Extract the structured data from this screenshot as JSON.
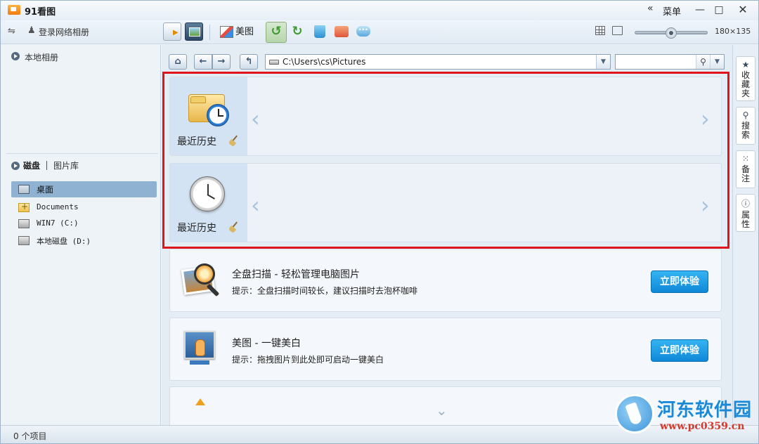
{
  "window": {
    "title": "91看图",
    "menu_label": "菜单",
    "menu_chevron": "«",
    "minimize": "—",
    "maximize": "□",
    "close": "✕"
  },
  "toolbar": {
    "login_label": "登录网络相册",
    "usb_glyph": "⇋",
    "user_glyph": "♟",
    "meitu_label": "美图",
    "rotate_left_glyph": "↺",
    "rotate_right_glyph": "↻",
    "zoom_value": "180×135",
    "zoom_level": 0.5
  },
  "left_panel": {
    "local_album_label": "本地相册",
    "disk_tab": "磁盘",
    "library_tab": "图片库",
    "tree": [
      {
        "label": "桌面",
        "icon": "desktop-icon",
        "selected": true
      },
      {
        "label": "Documents",
        "icon": "folder-icon",
        "selected": false
      },
      {
        "label": "WIN7 (C:)",
        "icon": "drive-icon",
        "selected": false
      },
      {
        "label": "本地磁盘 (D:)",
        "icon": "drive-icon",
        "selected": false
      }
    ]
  },
  "navbar": {
    "home_glyph": "⌂",
    "back_glyph": "←",
    "forward_glyph": "→",
    "up_glyph": "↰",
    "path": "C:\\Users\\cs\\Pictures",
    "dropdown_glyph": "▼",
    "search_value": "",
    "search_glyph": "⚲"
  },
  "history": [
    {
      "label": "最近历史",
      "icon": "folder-clock-icon"
    },
    {
      "label": "最近历史",
      "icon": "clock-icon"
    }
  ],
  "chevrons": {
    "left": "‹",
    "right": "›",
    "down": "⌄"
  },
  "features": [
    {
      "title": "全盘扫描 - 轻松管理电脑图片",
      "hint": "提示：全盘扫描时间较长，建议扫描时去泡杯咖啡",
      "button": "立即体验"
    },
    {
      "title": "美图 - 一键美白",
      "hint": "提示：拖拽图片到此处即可启动一键美白",
      "button": "立即体验"
    }
  ],
  "right_tabs": [
    {
      "label": "收藏夹",
      "icon_glyph": "★"
    },
    {
      "label": "搜索",
      "icon_glyph": "⚲"
    },
    {
      "label": "备注",
      "icon_glyph": "⁙"
    },
    {
      "label": "属性",
      "icon_glyph": "ⓘ"
    }
  ],
  "status": {
    "text": "0 个项目"
  },
  "watermark": {
    "name": "河东软件园",
    "url": "www.pc0359.cn"
  },
  "colors": {
    "highlight_frame": "#e0151b",
    "cta": "#1a9ce6",
    "selected_row": "#8fb1d2"
  }
}
